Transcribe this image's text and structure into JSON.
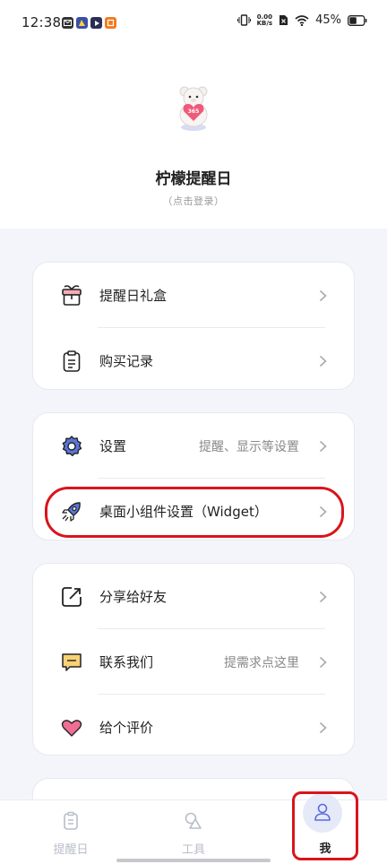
{
  "status_bar": {
    "time": "12:38",
    "net_speed_value": "0.00",
    "net_speed_unit": "KB/s",
    "battery": "45%"
  },
  "profile": {
    "app_name": "柠檬提醒日",
    "login_hint": "（点击登录）"
  },
  "groups": [
    {
      "items": [
        {
          "label": "提醒日礼盒",
          "value": "",
          "icon": "gift-box-icon"
        },
        {
          "label": "购买记录",
          "value": "",
          "icon": "clipboard-icon"
        }
      ]
    },
    {
      "items": [
        {
          "label": "设置",
          "value": "提醒、显示等设置",
          "icon": "gear-icon"
        },
        {
          "label": "桌面小组件设置（Widget）",
          "value": "",
          "icon": "rocket-icon"
        }
      ]
    },
    {
      "items": [
        {
          "label": "分享给好友",
          "value": "",
          "icon": "share-icon"
        },
        {
          "label": "联系我们",
          "value": "提需求点这里",
          "icon": "message-icon"
        },
        {
          "label": "给个评价",
          "value": "",
          "icon": "heart-icon"
        }
      ]
    }
  ],
  "tabbar": {
    "tabs": [
      {
        "label": "提醒日",
        "icon": "clipboard-icon"
      },
      {
        "label": "工具",
        "icon": "shapes-icon"
      },
      {
        "label": "我",
        "icon": "user-icon"
      }
    ],
    "active": 2
  },
  "colors": {
    "accent": "#5b6be0",
    "highlight": "#d9141c",
    "background": "#f4f5fa"
  }
}
